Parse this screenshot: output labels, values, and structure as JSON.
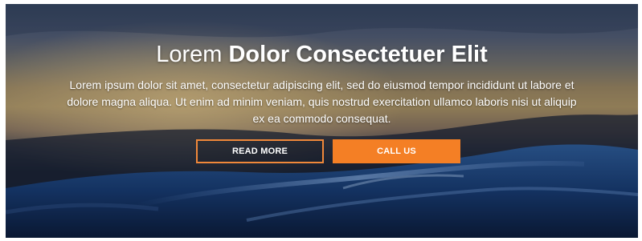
{
  "hero": {
    "headline_light": "Lorem",
    "headline_bold": "Dolor Consectetuer Elit",
    "paragraph": "Lorem ipsum dolor sit amet, consectetur adipiscing elit, sed do eiusmod tempor incididunt ut labore et dolore magna aliqua. Ut enim ad minim veniam, quis nostrud exercitation ullamco laboris nisi ut aliquip ex ea commodo consequat.",
    "buttons": {
      "read_more": "READ MORE",
      "call_us": "CALL US"
    }
  },
  "colors": {
    "accent": "#f47f25",
    "outline": "#f0883a",
    "text": "#ffffff"
  }
}
